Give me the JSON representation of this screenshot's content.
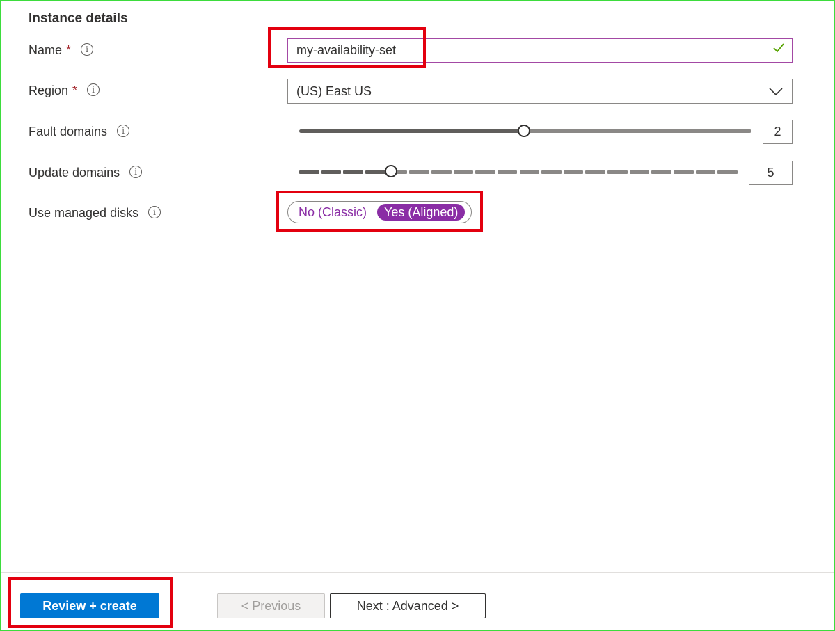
{
  "section": {
    "title": "Instance details"
  },
  "fields": {
    "name": {
      "label": "Name",
      "required_mark": "*",
      "value": "my-availability-set"
    },
    "region": {
      "label": "Region",
      "required_mark": "*",
      "value": "(US) East US"
    },
    "fault_domains": {
      "label": "Fault domains",
      "value": "2",
      "slider_fraction": 0.5
    },
    "update_domains": {
      "label": "Update domains",
      "value": "5",
      "slider_fraction": 0.2
    },
    "managed_disks": {
      "label": "Use managed disks",
      "options": [
        "No (Classic)",
        "Yes (Aligned)"
      ],
      "selected": "Yes (Aligned)"
    }
  },
  "footer": {
    "review_create": "Review + create",
    "previous": "< Previous",
    "next": "Next : Advanced >"
  },
  "colors": {
    "accent": "#8a2da5",
    "primary": "#0078d4",
    "highlight": "#e3000f",
    "valid": "#57a300"
  },
  "icons": {
    "info": "info-icon",
    "check": "checkmark-icon",
    "chevron": "chevron-down-icon"
  }
}
